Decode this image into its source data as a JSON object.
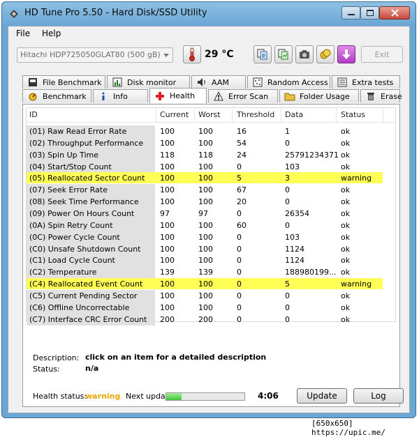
{
  "window": {
    "title": "HD Tune Pro 5.50 - Hard Disk/SSD Utility"
  },
  "menu": {
    "file": "File",
    "help": "Help"
  },
  "toolbar": {
    "drive": "Hitachi HDP725050GLAT80 (500 gB)",
    "temperature": "29 °C",
    "exit_label": "Exit",
    "icons": [
      "thermometer-icon",
      "copy-text-icon",
      "copy-screenshot-icon",
      "camera-icon",
      "coins-icon",
      "download-icon"
    ]
  },
  "tabs_top": [
    "File Benchmark",
    "Disk monitor",
    "AAM",
    "Random Access",
    "Extra tests"
  ],
  "tabs_bottom": [
    "Benchmark",
    "Info",
    "Health",
    "Error Scan",
    "Folder Usage",
    "Erase"
  ],
  "active_tab": "Health",
  "columns": [
    "ID",
    "Current",
    "Worst",
    "Threshold",
    "Data",
    "Status"
  ],
  "rows": [
    {
      "id": "(01) Raw Read Error Rate",
      "current": "100",
      "worst": "100",
      "threshold": "16",
      "data": "1",
      "status": "ok",
      "warning": false
    },
    {
      "id": "(02) Throughput Performance",
      "current": "100",
      "worst": "100",
      "threshold": "54",
      "data": "0",
      "status": "ok",
      "warning": false
    },
    {
      "id": "(03) Spin Up Time",
      "current": "118",
      "worst": "118",
      "threshold": "24",
      "data": "25791234371",
      "status": "ok",
      "warning": false
    },
    {
      "id": "(04) Start/Stop Count",
      "current": "100",
      "worst": "100",
      "threshold": "0",
      "data": "103",
      "status": "ok",
      "warning": false
    },
    {
      "id": "(05) Reallocated Sector Count",
      "current": "100",
      "worst": "100",
      "threshold": "5",
      "data": "3",
      "status": "warning",
      "warning": true
    },
    {
      "id": "(07) Seek Error Rate",
      "current": "100",
      "worst": "100",
      "threshold": "67",
      "data": "0",
      "status": "ok",
      "warning": false
    },
    {
      "id": "(08) Seek Time Performance",
      "current": "100",
      "worst": "100",
      "threshold": "20",
      "data": "0",
      "status": "ok",
      "warning": false
    },
    {
      "id": "(09) Power On Hours Count",
      "current": "97",
      "worst": "97",
      "threshold": "0",
      "data": "26354",
      "status": "ok",
      "warning": false
    },
    {
      "id": "(0A) Spin Retry Count",
      "current": "100",
      "worst": "100",
      "threshold": "60",
      "data": "0",
      "status": "ok",
      "warning": false
    },
    {
      "id": "(0C) Power Cycle Count",
      "current": "100",
      "worst": "100",
      "threshold": "0",
      "data": "103",
      "status": "ok",
      "warning": false
    },
    {
      "id": "(C0) Unsafe Shutdown Count",
      "current": "100",
      "worst": "100",
      "threshold": "0",
      "data": "1124",
      "status": "ok",
      "warning": false
    },
    {
      "id": "(C1) Load Cycle Count",
      "current": "100",
      "worst": "100",
      "threshold": "0",
      "data": "1124",
      "status": "ok",
      "warning": false
    },
    {
      "id": "(C2) Temperature",
      "current": "139",
      "worst": "139",
      "threshold": "0",
      "data": "188980199...",
      "status": "ok",
      "warning": false
    },
    {
      "id": "(C4) Reallocated Event Count",
      "current": "100",
      "worst": "100",
      "threshold": "0",
      "data": "5",
      "status": "warning",
      "warning": true
    },
    {
      "id": "(C5) Current Pending Sector",
      "current": "100",
      "worst": "100",
      "threshold": "0",
      "data": "0",
      "status": "ok",
      "warning": false
    },
    {
      "id": "(C6) Offline Uncorrectable",
      "current": "100",
      "worst": "100",
      "threshold": "0",
      "data": "0",
      "status": "ok",
      "warning": false
    },
    {
      "id": "(C7) Interface CRC Error Count",
      "current": "200",
      "worst": "200",
      "threshold": "0",
      "data": "0",
      "status": "ok",
      "warning": false
    }
  ],
  "description": {
    "label": "Description:",
    "value": "click on an item for a detailed description",
    "status_label": "Status:",
    "status_value": "n/a"
  },
  "footer": {
    "health_label": "Health status:",
    "health_value": "warning",
    "next_update_label": "Next update:",
    "progress_fraction": 0.2,
    "countdown": "4:06",
    "update_button": "Update",
    "log_button": "Log"
  },
  "colors": {
    "warning_highlight": "#ffff55",
    "health_warning_text": "#e8a400",
    "progress_fill": "#3cc63a"
  },
  "watermark": "[650x650] https://upic.me/"
}
